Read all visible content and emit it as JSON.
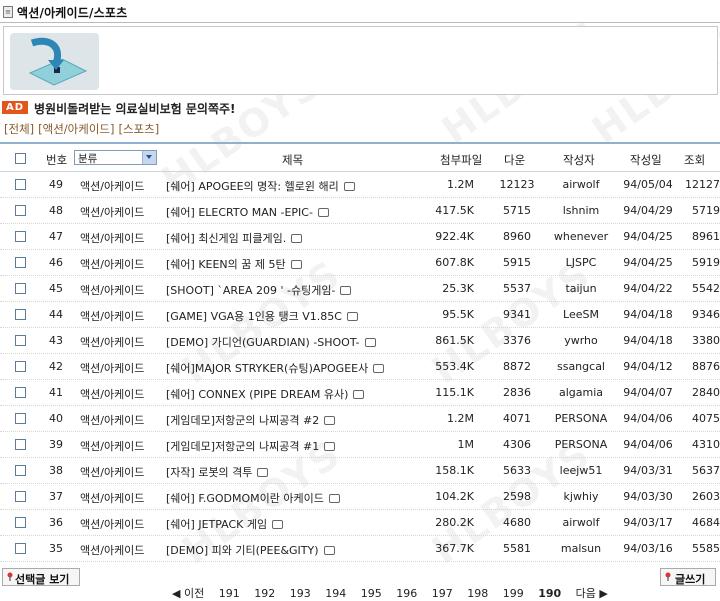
{
  "header": {
    "title": "액션/아케이드/스포츠",
    "icon": "document-icon"
  },
  "ad": {
    "badge": "AD",
    "text": "병원비돌려받는 의료실비보험 문의쪽주!"
  },
  "breadcrumb": {
    "items": [
      "[전체]",
      "[액션/아케이드]",
      "[스포츠]"
    ]
  },
  "table": {
    "headers": {
      "num": "번호",
      "category_select": "분류",
      "title": "제목",
      "attach": "첨부파일",
      "down": "다운",
      "author": "작성자",
      "date": "작성일",
      "hits": "조회"
    },
    "rows": [
      {
        "num": "49",
        "cat": "액션/아케이드",
        "title": "[쉐어] APOGEE의 명작: 헬로윈 해리",
        "size": "1.2M",
        "down": "12123",
        "author": "airwolf",
        "date": "94/05/04",
        "hits": "12127"
      },
      {
        "num": "48",
        "cat": "액션/아케이드",
        "title": "[쉐어] ELECRTO MAN -EPIC-",
        "size": "417.5K",
        "down": "5715",
        "author": "lshnim",
        "date": "94/04/29",
        "hits": "5719"
      },
      {
        "num": "47",
        "cat": "액션/아케이드",
        "title": "[쉐어] 최신게임 피클게임.",
        "size": "922.4K",
        "down": "8960",
        "author": "whenever",
        "date": "94/04/25",
        "hits": "8961"
      },
      {
        "num": "46",
        "cat": "액션/아케이드",
        "title": "[쉐어] KEEN의 꿈 제 5탄",
        "size": "607.8K",
        "down": "5915",
        "author": "LJSPC",
        "date": "94/04/25",
        "hits": "5919"
      },
      {
        "num": "45",
        "cat": "액션/아케이드",
        "title": "[SHOOT] `AREA 209 ' -슈팅게임-",
        "size": "25.3K",
        "down": "5537",
        "author": "taijun",
        "date": "94/04/22",
        "hits": "5542"
      },
      {
        "num": "44",
        "cat": "액션/아케이드",
        "title": "[GAME] VGA용 1인용 탱크 V1.85C",
        "size": "95.5K",
        "down": "9341",
        "author": "LeeSM",
        "date": "94/04/18",
        "hits": "9346"
      },
      {
        "num": "43",
        "cat": "액션/아케이드",
        "title": "[DEMO] 가디언(GUARDIAN) -SHOOT-",
        "size": "861.5K",
        "down": "3376",
        "author": "ywrho",
        "date": "94/04/18",
        "hits": "3380"
      },
      {
        "num": "42",
        "cat": "액션/아케이드",
        "title": "[쉐어]MAJOR STRYKER(슈팅)APOGEE사",
        "size": "553.4K",
        "down": "8872",
        "author": "ssangcal",
        "date": "94/04/12",
        "hits": "8876"
      },
      {
        "num": "41",
        "cat": "액션/아케이드",
        "title": "[쉐어] CONNEX (PIPE DREAM 유사)",
        "size": "115.1K",
        "down": "2836",
        "author": "algamia",
        "date": "94/04/07",
        "hits": "2840"
      },
      {
        "num": "40",
        "cat": "액션/아케이드",
        "title": "[게임데모]저항군의 나찌공격 #2",
        "size": "1.2M",
        "down": "4071",
        "author": "PERSONA",
        "date": "94/04/06",
        "hits": "4075"
      },
      {
        "num": "39",
        "cat": "액션/아케이드",
        "title": "[게임데모]저항군의 나찌공격 #1",
        "size": "1M",
        "down": "4306",
        "author": "PERSONA",
        "date": "94/04/06",
        "hits": "4310"
      },
      {
        "num": "38",
        "cat": "액션/아케이드",
        "title": "[자작] 로봇의 격투",
        "size": "158.1K",
        "down": "5633",
        "author": "leejw51",
        "date": "94/03/31",
        "hits": "5637"
      },
      {
        "num": "37",
        "cat": "액션/아케이드",
        "title": "[쉐어] F.GODMOM이란 아케이드",
        "size": "104.2K",
        "down": "2598",
        "author": "kjwhiy",
        "date": "94/03/30",
        "hits": "2603"
      },
      {
        "num": "36",
        "cat": "액션/아케이드",
        "title": "[쉐어] JETPACK 게임",
        "size": "280.2K",
        "down": "4680",
        "author": "airwolf",
        "date": "94/03/17",
        "hits": "4684"
      },
      {
        "num": "35",
        "cat": "액션/아케이드",
        "title": "[DEMO] 피와 기티(PEE&GITY)",
        "size": "367.7K",
        "down": "5581",
        "author": "malsun",
        "date": "94/03/16",
        "hits": "5585"
      }
    ]
  },
  "actions": {
    "view_selected": "선택글 보기",
    "write": "글쓰기"
  },
  "pager": {
    "prev": "◀ 이전",
    "pages": [
      "191",
      "192",
      "193",
      "194",
      "195",
      "196",
      "197",
      "198",
      "199",
      "190"
    ],
    "current": "190",
    "next": "다음 ▶"
  },
  "watermark": "HLBOYS",
  "colors": {
    "ad_badge": "#e2561d",
    "header_border": "#8fb0cf",
    "breadcrumb": "#8a5a2a"
  }
}
